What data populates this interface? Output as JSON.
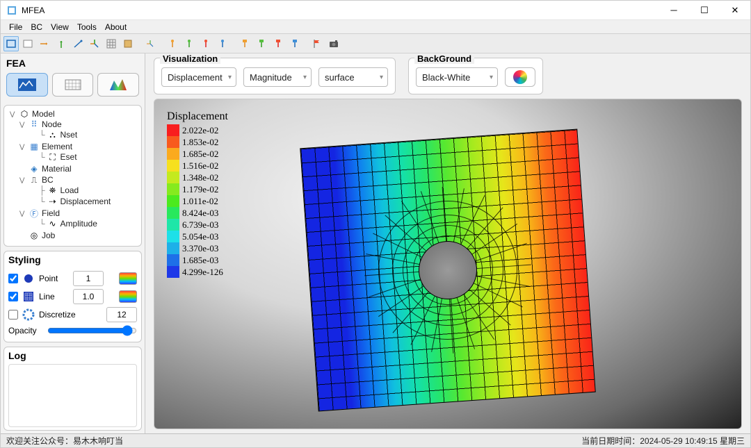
{
  "title": "MFEA",
  "menu": [
    "File",
    "BC",
    "View",
    "Tools",
    "About"
  ],
  "fea_title": "FEA",
  "vis_title": "Visualization",
  "bg_title": "BackGround",
  "vis_dropdowns": {
    "quantity": "Displacement",
    "component": "Magnitude",
    "representation": "surface"
  },
  "bg_dropdown": "Black-White",
  "tree": {
    "root": "Model",
    "node": "Node",
    "nset": "Nset",
    "element": "Element",
    "eset": "Eset",
    "material": "Material",
    "bc": "BC",
    "load": "Load",
    "disp": "Displacement",
    "field": "Field",
    "amplitude": "Amplitude",
    "job": "Job"
  },
  "styling": {
    "title": "Styling",
    "point": "Point",
    "point_val": "1",
    "line": "Line",
    "line_val": "1.0",
    "discretize": "Discretize",
    "discretize_val": "12",
    "opacity": "Opacity"
  },
  "log_title": "Log",
  "legend": {
    "title": "Displacement",
    "values": [
      "2.022e-02",
      "1.853e-02",
      "1.685e-02",
      "1.516e-02",
      "1.348e-02",
      "1.179e-02",
      "1.011e-02",
      "8.424e-03",
      "6.739e-03",
      "5.054e-03",
      "3.370e-03",
      "1.685e-03",
      "4.299e-126"
    ],
    "colors": [
      "#f81e1e",
      "#f85a1e",
      "#fbaa1e",
      "#f6e01e",
      "#c4ea1e",
      "#86ea1e",
      "#4cea1e",
      "#28e85c",
      "#1ee6a8",
      "#1ee0e8",
      "#1eb0e8",
      "#1e70e8",
      "#1e38e8"
    ]
  },
  "status_left": "欢迎关注公众号：易木木响叮当",
  "status_right": "当前日期时间：2024-05-29 10:49:15 星期三"
}
